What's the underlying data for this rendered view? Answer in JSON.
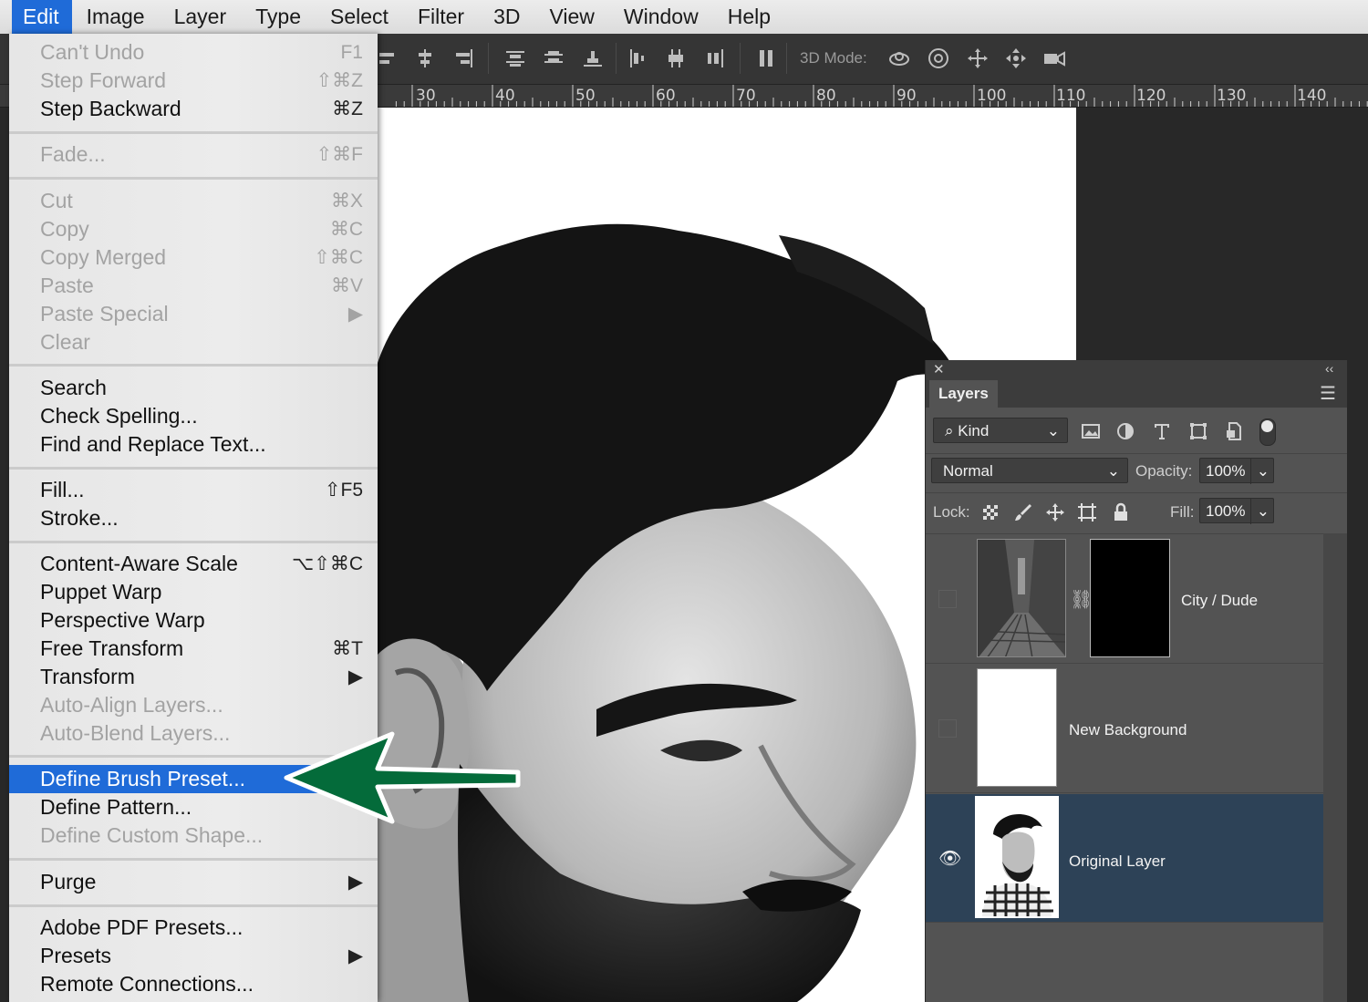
{
  "menubar": {
    "items": [
      "Edit",
      "Image",
      "Layer",
      "Type",
      "Select",
      "Filter",
      "3D",
      "View",
      "Window",
      "Help"
    ]
  },
  "options_bar": {
    "mode_label": "3D Mode:"
  },
  "ruler": {
    "labels": [
      "30",
      "40",
      "50",
      "60",
      "70",
      "80",
      "90",
      "100",
      "110",
      "120",
      "130",
      "140"
    ]
  },
  "edit_menu": {
    "items": [
      {
        "label": "Can't Undo",
        "shortcut": "F1",
        "disabled": true
      },
      {
        "label": "Step Forward",
        "shortcut": "⇧⌘Z",
        "disabled": true
      },
      {
        "label": "Step Backward",
        "shortcut": "⌘Z",
        "disabled": false
      },
      {
        "label": "Fade...",
        "shortcut": "⇧⌘F",
        "disabled": true
      },
      {
        "label": "Cut",
        "shortcut": "⌘X",
        "disabled": true
      },
      {
        "label": "Copy",
        "shortcut": "⌘C",
        "disabled": true
      },
      {
        "label": "Copy Merged",
        "shortcut": "⇧⌘C",
        "disabled": true
      },
      {
        "label": "Paste",
        "shortcut": "⌘V",
        "disabled": true
      },
      {
        "label": "Paste Special",
        "shortcut": "▶",
        "disabled": true
      },
      {
        "label": "Clear",
        "shortcut": "",
        "disabled": true
      },
      {
        "label": "Search",
        "shortcut": "",
        "disabled": false
      },
      {
        "label": "Check Spelling...",
        "shortcut": "",
        "disabled": false
      },
      {
        "label": "Find and Replace Text...",
        "shortcut": "",
        "disabled": false
      },
      {
        "label": "Fill...",
        "shortcut": "⇧F5",
        "disabled": false
      },
      {
        "label": "Stroke...",
        "shortcut": "",
        "disabled": false
      },
      {
        "label": "Content-Aware Scale",
        "shortcut": "⌥⇧⌘C",
        "disabled": false
      },
      {
        "label": "Puppet Warp",
        "shortcut": "",
        "disabled": false
      },
      {
        "label": "Perspective Warp",
        "shortcut": "",
        "disabled": false
      },
      {
        "label": "Free Transform",
        "shortcut": "⌘T",
        "disabled": false
      },
      {
        "label": "Transform",
        "shortcut": "▶",
        "disabled": false
      },
      {
        "label": "Auto-Align Layers...",
        "shortcut": "",
        "disabled": true
      },
      {
        "label": "Auto-Blend Layers...",
        "shortcut": "",
        "disabled": true
      },
      {
        "label": "Define Brush Preset...",
        "shortcut": "",
        "disabled": false,
        "highlighted": true
      },
      {
        "label": "Define Pattern...",
        "shortcut": "",
        "disabled": false
      },
      {
        "label": "Define Custom Shape...",
        "shortcut": "",
        "disabled": true
      },
      {
        "label": "Purge",
        "shortcut": "▶",
        "disabled": false
      },
      {
        "label": "Adobe PDF Presets...",
        "shortcut": "",
        "disabled": false
      },
      {
        "label": "Presets",
        "shortcut": "▶",
        "disabled": false
      },
      {
        "label": "Remote Connections...",
        "shortcut": "",
        "disabled": false
      }
    ]
  },
  "layers_panel": {
    "tab": "Layers",
    "filter_kind": "Kind",
    "blend_mode": "Normal",
    "opacity_label": "Opacity:",
    "opacity_value": "100%",
    "lock_label": "Lock:",
    "fill_label": "Fill:",
    "fill_value": "100%",
    "layers": [
      {
        "name": "City / Dude",
        "visible": false,
        "selected": false
      },
      {
        "name": "New Background",
        "visible": false,
        "selected": false
      },
      {
        "name": "Original Layer",
        "visible": true,
        "selected": true
      }
    ]
  },
  "colors": {
    "menu_highlight": "#1f6bd8",
    "selected_layer": "#2d4257",
    "arrow": "#046b3a"
  }
}
